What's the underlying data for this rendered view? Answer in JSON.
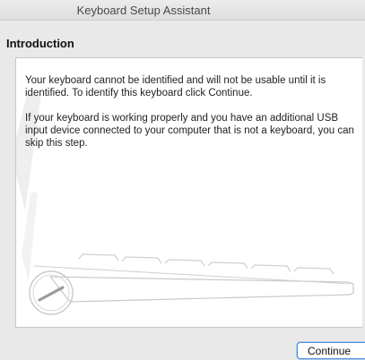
{
  "window": {
    "title": "Keyboard Setup Assistant"
  },
  "section": {
    "title": "Introduction"
  },
  "body": {
    "paragraph1": "Your keyboard cannot be identified and will not be usable until it is identified. To identify this keyboard click Continue.",
    "paragraph2": "If your keyboard is working properly and you have an additional USB input device connected to your computer that is not a keyboard, you can skip this step."
  },
  "illustration": {
    "icon": "keyboard-illustration-icon"
  },
  "buttons": {
    "continue_label": "Continue"
  },
  "colors": {
    "accent": "#4a90e2",
    "window_bg": "#e9e9e9",
    "panel_bg": "#ffffff"
  }
}
